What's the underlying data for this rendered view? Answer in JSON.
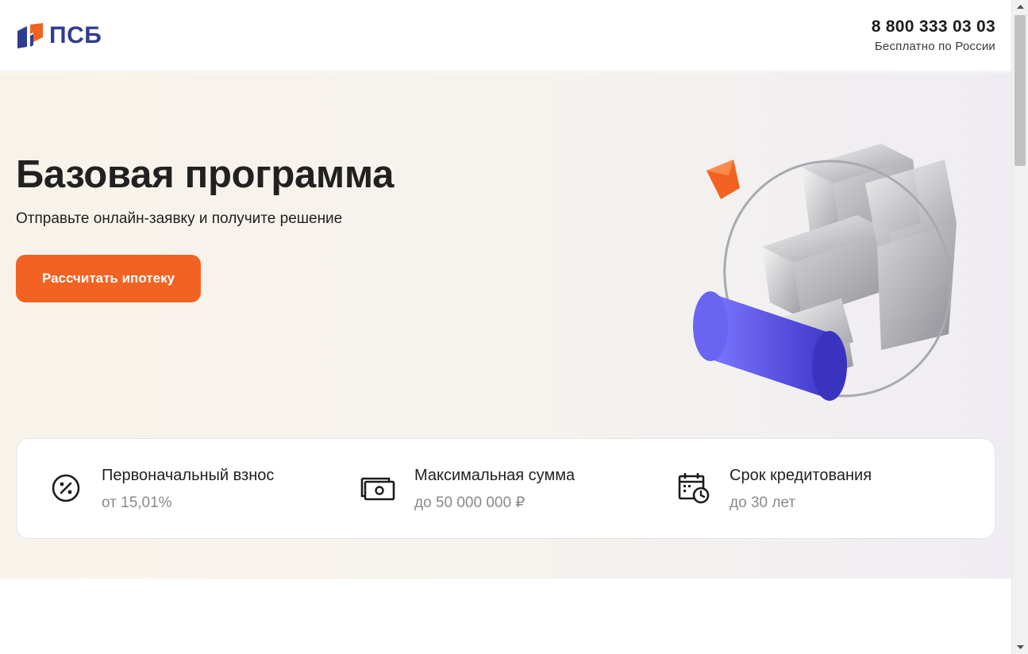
{
  "header": {
    "logo_text": "ПСБ",
    "phone": "8 800 333 03 03",
    "phone_note": "Бесплатно по России"
  },
  "hero": {
    "title": "Базовая программа",
    "subtitle": "Отправьте онлайн-заявку и получите решение",
    "cta_label": "Рассчитать ипотеку"
  },
  "info": [
    {
      "icon": "percent-icon",
      "title": "Первоначальный взнос",
      "value": "от 15,01%"
    },
    {
      "icon": "banknote-icon",
      "title": "Максимальная сумма",
      "value": "до 50 000 000 ₽"
    },
    {
      "icon": "calendar-clock-icon",
      "title": "Срок кредитования",
      "value": "до 30 лет"
    }
  ],
  "colors": {
    "brand_blue": "#2f3d8f",
    "accent_orange": "#f26322",
    "illustration_violet": "#5b57e6"
  }
}
